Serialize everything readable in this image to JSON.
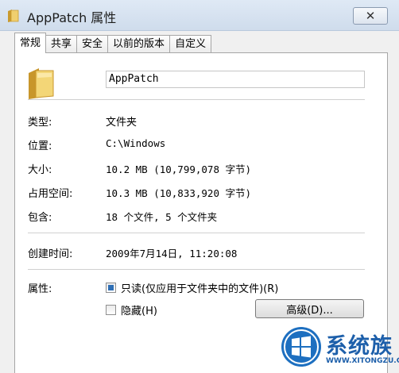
{
  "window": {
    "title": "AppPatch 属性",
    "close_glyph": "✕"
  },
  "tabs": [
    "常规",
    "共享",
    "安全",
    "以前的版本",
    "自定义"
  ],
  "general": {
    "name_value": "AppPatch",
    "rows": [
      {
        "label": "类型:",
        "value": "文件夹"
      },
      {
        "label": "位置:",
        "value": "C:\\Windows"
      },
      {
        "label": "大小:",
        "value": "10.2 MB (10,799,078 字节)"
      },
      {
        "label": "占用空间:",
        "value": "10.3 MB (10,833,920 字节)"
      },
      {
        "label": "包含:",
        "value": "18 个文件, 5 个文件夹"
      }
    ],
    "created_label": "创建时间:",
    "created_value": "2009年7月14日, 11:20:08",
    "attributes_label": "属性:",
    "readonly_label": "只读(仅应用于文件夹中的文件)(R)",
    "hidden_label": "隐藏(H)",
    "advanced_button": "高级(D)..."
  },
  "watermark": {
    "name": "系统族",
    "url": "WWW.XITONGZU.COM"
  },
  "colors": {
    "folder": "#e8c65a",
    "accent": "#1d5faa"
  }
}
